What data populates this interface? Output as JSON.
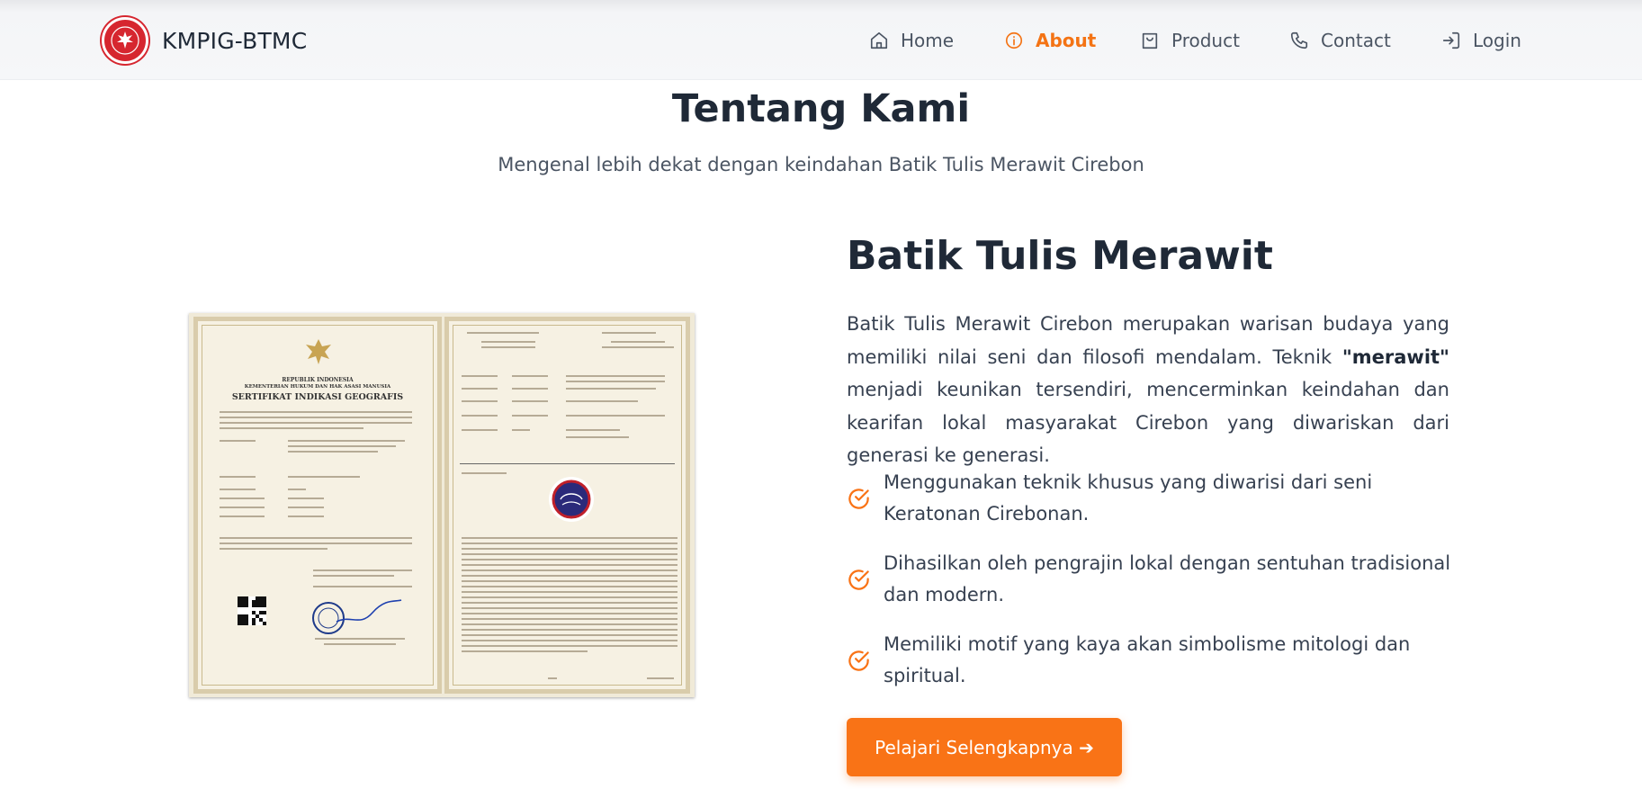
{
  "brand": {
    "name": "KMPIG-BTMC"
  },
  "nav": {
    "home": "Home",
    "about": "About",
    "product": "Product",
    "contact": "Contact",
    "login": "Login"
  },
  "colors": {
    "accent": "#f97316",
    "text": "#1f2937",
    "muted": "#4b5563",
    "logo_red": "#d6262f"
  },
  "hero": {
    "title": "Tentang Kami",
    "subtitle": "Mengenal lebih dekat dengan keindahan Batik Tulis Merawit Cirebon"
  },
  "about": {
    "heading": "Batik Tulis Merawit",
    "desc_before": "Batik Tulis Merawit Cirebon merupakan warisan budaya yang memiliki nilai seni dan filosofi mendalam. Teknik ",
    "desc_bold": "\"merawit\"",
    "desc_after": " menjadi keunikan tersendiri, mencerminkan keindahan dan kearifan lokal masyarakat Cirebon yang diwariskan dari generasi ke generasi.",
    "features": [
      "Menggunakan teknik khusus yang diwarisi dari seni Keratonan Cirebonan.",
      "Dihasilkan oleh pengrajin lokal dengan sentuhan tradisional dan modern.",
      "Memiliki motif yang kaya akan simbolisme mitologi dan spiritual."
    ],
    "button": "Pelajari Selengkapnya ➔"
  },
  "certificate": {
    "republic": "REPUBLIK INDONESIA",
    "ministry": "KEMENTERIAN HUKUM DAN HAK ASASI MANUSIA",
    "title": "SERTIFIKAT INDIKASI GEOGRAFIS"
  },
  "icons": [
    "home-icon",
    "info-icon",
    "shopping-bag-icon",
    "phone-icon",
    "login-icon",
    "check-circle-icon"
  ]
}
